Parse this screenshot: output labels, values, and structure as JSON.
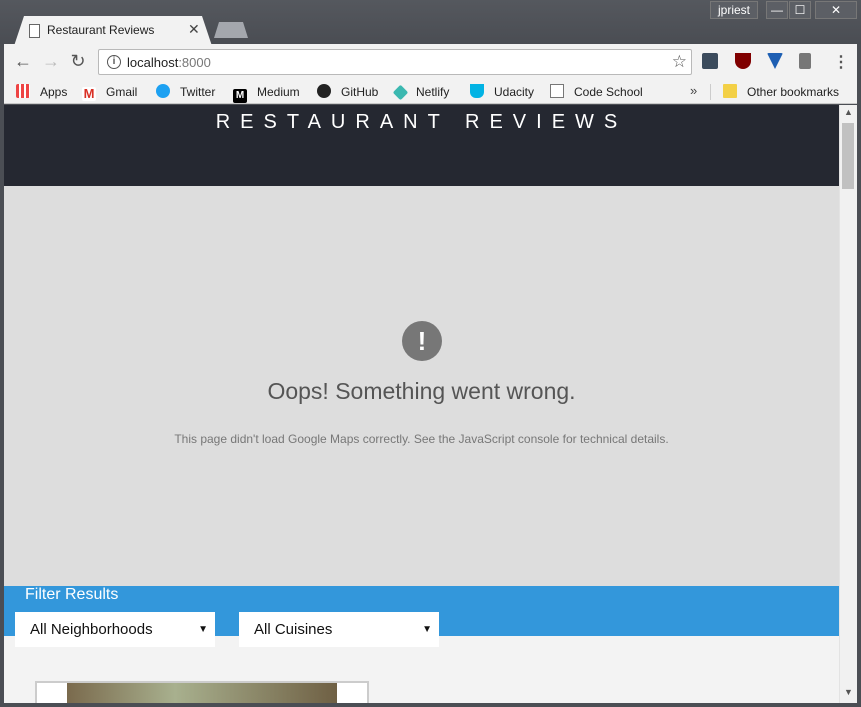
{
  "window": {
    "user": "jpriest",
    "minimize_glyph": "—",
    "maximize_glyph": "☐",
    "close_glyph": "✕"
  },
  "tab": {
    "title": "Restaurant Reviews",
    "close_glyph": "✕"
  },
  "toolbar": {
    "back_glyph": "←",
    "forward_glyph": "→",
    "reload_glyph": "↻",
    "url_host": "localhost",
    "url_port": ":8000",
    "star_glyph": "☆",
    "menu_glyph": "⋮",
    "extensions": [
      "udacity-ext",
      "ublock",
      "vpn-shield",
      "panel"
    ]
  },
  "bookmarks": {
    "items": [
      {
        "label": "Apps",
        "icon": "apps-grid"
      },
      {
        "label": "Gmail",
        "icon": "gmail"
      },
      {
        "label": "Twitter",
        "icon": "twitter"
      },
      {
        "label": "Medium",
        "icon": "medium"
      },
      {
        "label": "GitHub",
        "icon": "github"
      },
      {
        "label": "Netlify",
        "icon": "netlify"
      },
      {
        "label": "Udacity",
        "icon": "udacity"
      },
      {
        "label": "Code School",
        "icon": "page"
      }
    ],
    "more_glyph": "»",
    "other": "Other bookmarks"
  },
  "page": {
    "title": "RESTAURANT REVIEWS",
    "map_error": {
      "icon_glyph": "!",
      "title": "Oops! Something went wrong.",
      "detail": "This page didn't load Google Maps correctly. See the JavaScript console for technical details."
    },
    "filter": {
      "label": "Filter Results",
      "neighborhood_selected": "All Neighborhoods",
      "cuisine_selected": "All Cuisines",
      "caret": "▼"
    }
  },
  "scrollbar": {
    "up": "▲",
    "down": "▼"
  },
  "colors": {
    "header_bg": "#252831",
    "filter_bg": "#3397db",
    "map_bg": "#dddddd"
  }
}
